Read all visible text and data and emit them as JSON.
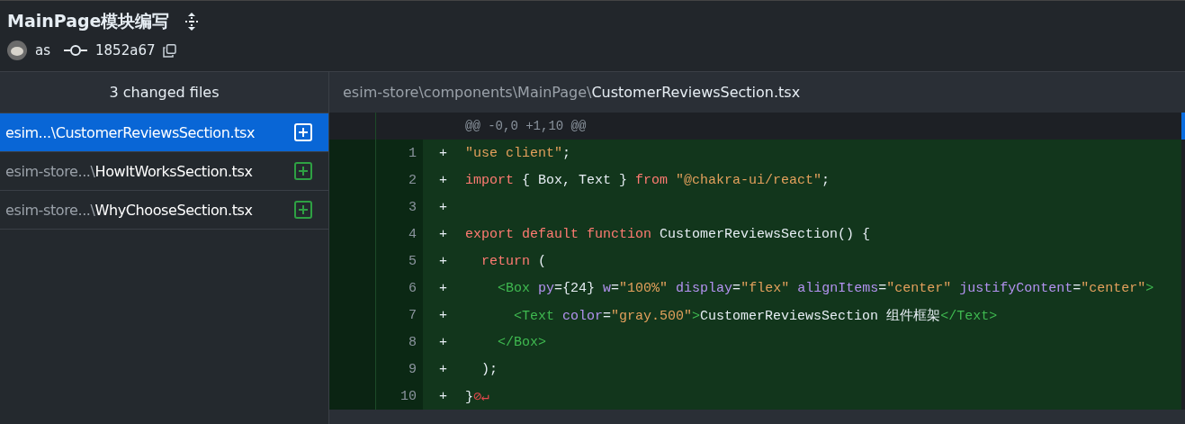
{
  "header": {
    "title": "MainPage模块编写",
    "author": "as",
    "commit": "1852a67"
  },
  "files_panel": {
    "heading": "3 changed files",
    "files": [
      {
        "dir": "esim...\\",
        "name": "CustomerReviewsSection.tsx",
        "selected": true
      },
      {
        "dir": "esim-store...\\",
        "name": "HowItWorksSection.tsx",
        "selected": false
      },
      {
        "dir": "esim-store...\\",
        "name": "WhyChooseSection.tsx",
        "selected": false
      }
    ]
  },
  "diff": {
    "path_dir": "esim-store\\components\\MainPage\\",
    "path_name": "CustomerReviewsSection.tsx",
    "hunk": "@@ -0,0 +1,10 @@",
    "lines": [
      {
        "number": "1",
        "sign": "+",
        "tokens": [
          {
            "kind": "string",
            "text": "\"use client\""
          },
          {
            "kind": "plain",
            "text": ";"
          }
        ]
      },
      {
        "number": "2",
        "sign": "+",
        "tokens": [
          {
            "kind": "keyword",
            "text": "import"
          },
          {
            "kind": "plain",
            "text": " { Box, Text } "
          },
          {
            "kind": "keyword",
            "text": "from"
          },
          {
            "kind": "string",
            "text": " \"@chakra-ui/react\""
          },
          {
            "kind": "plain",
            "text": ";"
          }
        ]
      },
      {
        "number": "3",
        "sign": "+"
      },
      {
        "number": "4",
        "sign": "+",
        "tokens": [
          {
            "kind": "keyword",
            "text": "export default function"
          },
          {
            "kind": "plain",
            "text": " CustomerReviewsSection() {"
          }
        ]
      },
      {
        "number": "5",
        "sign": "+",
        "tokens": [
          {
            "kind": "keyword",
            "text": "  return"
          },
          {
            "kind": "plain",
            "text": " ("
          }
        ]
      },
      {
        "number": "6",
        "sign": "+",
        "tokens": [
          {
            "kind": "tag",
            "text": "    <Box"
          },
          {
            "kind": "attr",
            "text": " py"
          },
          {
            "kind": "plain",
            "text": "={24} "
          },
          {
            "kind": "attr",
            "text": "w"
          },
          {
            "kind": "plain",
            "text": "="
          },
          {
            "kind": "string",
            "text": "\"100%\""
          },
          {
            "kind": "attr",
            "text": " display"
          },
          {
            "kind": "plain",
            "text": "="
          },
          {
            "kind": "string",
            "text": "\"flex\""
          },
          {
            "kind": "attr",
            "text": " alignItems"
          },
          {
            "kind": "plain",
            "text": "="
          },
          {
            "kind": "string",
            "text": "\"center\""
          },
          {
            "kind": "attr",
            "text": " justifyContent"
          },
          {
            "kind": "plain",
            "text": "="
          },
          {
            "kind": "string",
            "text": "\"center\""
          },
          {
            "kind": "tag",
            "text": ">"
          }
        ]
      },
      {
        "number": "7",
        "sign": "+",
        "tokens": [
          {
            "kind": "tag",
            "text": "      <Text"
          },
          {
            "kind": "attr",
            "text": " color"
          },
          {
            "kind": "plain",
            "text": "="
          },
          {
            "kind": "string",
            "text": "\"gray.500\""
          },
          {
            "kind": "tag",
            "text": ">"
          },
          {
            "kind": "plain",
            "text": "CustomerReviewsSection 组件框架"
          },
          {
            "kind": "tag",
            "text": "</Text>"
          }
        ]
      },
      {
        "number": "8",
        "sign": "+",
        "tokens": [
          {
            "kind": "tag",
            "text": "    </Box>"
          }
        ]
      },
      {
        "number": "9",
        "sign": "+",
        "tokens": [
          {
            "kind": "plain",
            "text": "  );"
          }
        ]
      },
      {
        "number": "10",
        "sign": "+",
        "tokens": [
          {
            "kind": "plain",
            "text": "}"
          },
          {
            "kind": "eol",
            "text": "⊘↵"
          }
        ]
      }
    ]
  }
}
